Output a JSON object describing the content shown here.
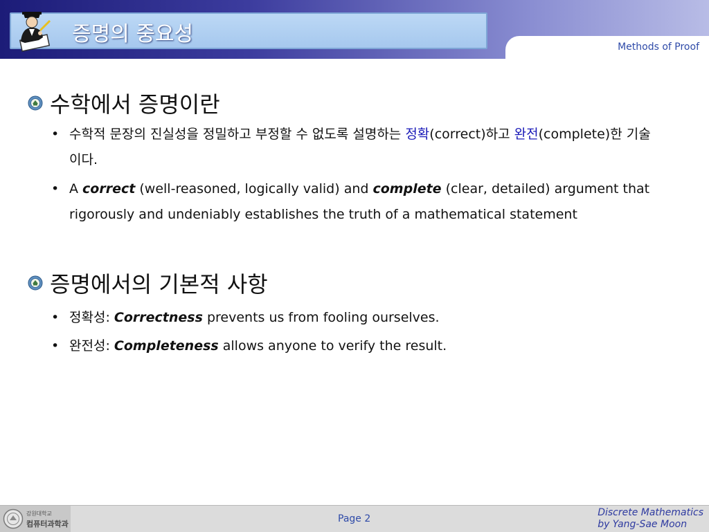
{
  "header": {
    "title": "증명의 중요성",
    "subject": "Methods of Proof",
    "logo_icon": "scholar-writing-icon"
  },
  "colors": {
    "header_dark": "#1c1c78",
    "header_light": "#b8bce6",
    "accent_blue": "#1a1ab8",
    "link_blue": "#2e4aa8"
  },
  "sections": [
    {
      "heading": "수학에서 증명이란",
      "items": [
        {
          "part1": "수학적 문장의 진실성을 정밀하고 부정할 수 없도록 설명하는 ",
          "hl1": "정확",
          "part2": "(correct)하고 ",
          "hl2": "완전",
          "part3": "(complete)한 기술이다."
        },
        {
          "part1": "A ",
          "em1": "correct",
          "part2": " (well-reasoned, logically valid) and ",
          "em2": "complete",
          "part3": " (clear, detailed) argument that rigorously and undeniably establishes the truth of a mathematical statement"
        }
      ]
    },
    {
      "heading": "증명에서의 기본적 사항",
      "items": [
        {
          "label": "정확성",
          "sep": ": ",
          "em": "Correctness",
          "rest": " prevents us from fooling ourselves."
        },
        {
          "label": "완전성",
          "sep": ": ",
          "em": "Completeness",
          "rest": " allows anyone to verify the result."
        }
      ]
    }
  ],
  "footer": {
    "university": "강원대학교",
    "department": "컴퓨터과학과",
    "page": "Page 2",
    "course_line1": "Discrete Mathematics",
    "course_line2": "by Yang-Sae Moon"
  }
}
